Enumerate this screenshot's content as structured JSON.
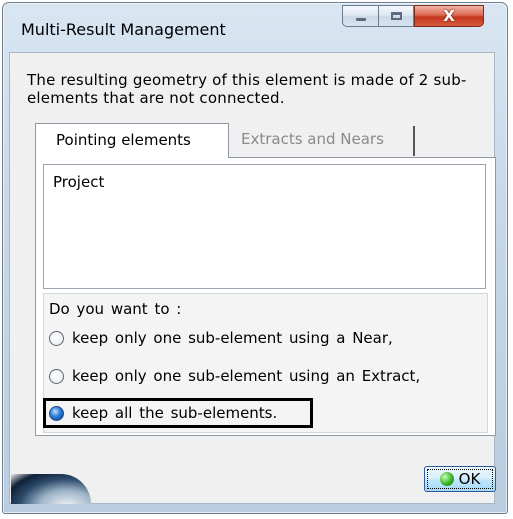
{
  "window": {
    "title": "Multi-Result Management",
    "controls": {
      "minimize_icon": "minimize-icon",
      "maximize_icon": "maximize-icon",
      "close_glyph": "X"
    }
  },
  "message": "The resulting geometry of this element is made of 2 sub-elements that are not connected.",
  "tabs": [
    {
      "label": "Pointing elements",
      "active": true
    },
    {
      "label": "Extracts and Nears",
      "active": false
    }
  ],
  "list": {
    "items": [
      "Project"
    ]
  },
  "question": "Do you want to :",
  "options": [
    {
      "label": "keep only one sub-element using a Near,",
      "selected": false
    },
    {
      "label": "keep only one sub-element using an Extract,",
      "selected": false
    },
    {
      "label": "keep all the sub-elements.",
      "selected": true
    }
  ],
  "ok_button": {
    "label": "OK",
    "icon": "green-ok-icon"
  },
  "colors": {
    "close_button": "#c3381f",
    "ok_icon": "#36b325",
    "radio_checked": "#2a7bd6"
  }
}
